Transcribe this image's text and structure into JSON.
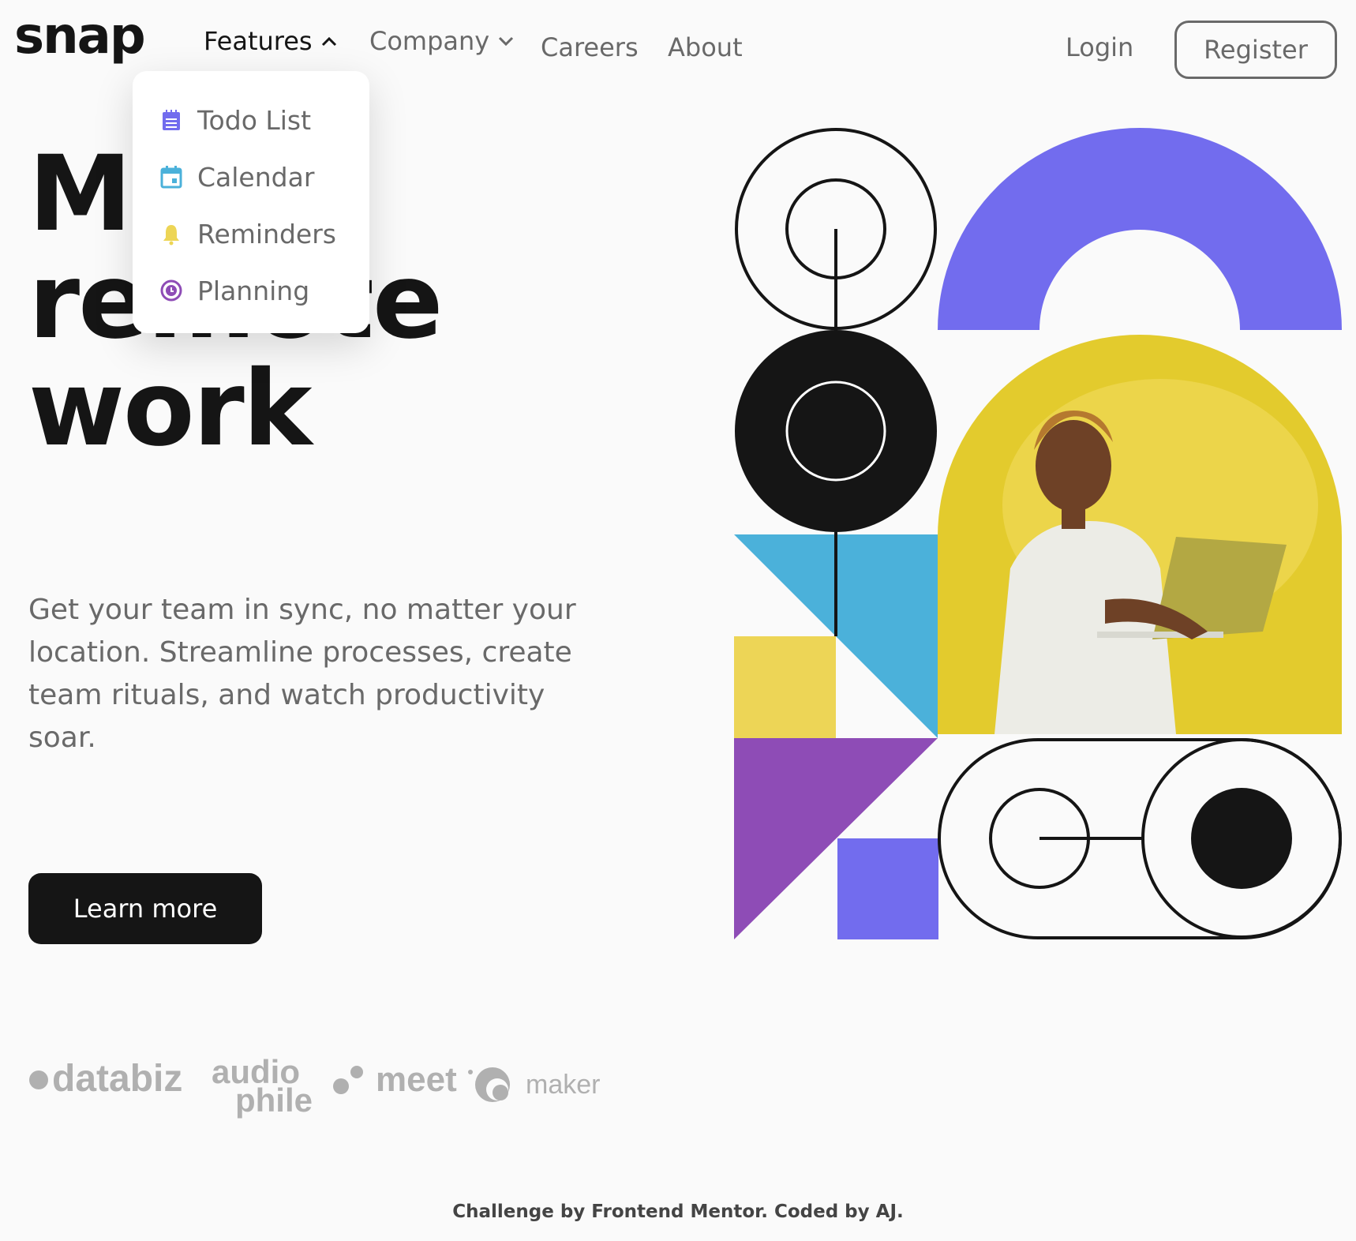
{
  "header": {
    "logo": "snap",
    "nav": [
      {
        "label": "Features",
        "expanded": true
      },
      {
        "label": "Company",
        "expanded": false
      },
      {
        "label": "Careers"
      },
      {
        "label": "About"
      }
    ],
    "login_label": "Login",
    "register_label": "Register"
  },
  "features_menu": [
    {
      "label": "Todo List",
      "icon": "todo-icon",
      "color": "#726cee"
    },
    {
      "label": "Calendar",
      "icon": "calendar-icon",
      "color": "#4bb1da"
    },
    {
      "label": "Reminders",
      "icon": "bell-icon",
      "color": "#edd556"
    },
    {
      "label": "Planning",
      "icon": "planning-icon",
      "color": "#8e4cb6"
    }
  ],
  "hero": {
    "title_line1": "Make",
    "title_line2": "remote",
    "title_line3": "work",
    "description": "Get your team in sync, no matter your location. Streamline processes, create team rituals, and watch productivity soar.",
    "cta_label": "Learn more"
  },
  "clients": [
    {
      "name": "databiz"
    },
    {
      "name": "audio",
      "sub": "phile"
    },
    {
      "name": "meet"
    },
    {
      "name": "maker"
    }
  ],
  "footer": {
    "attribution": "Challenge by Frontend Mentor. Coded by AJ."
  },
  "colors": {
    "text": "#151515",
    "muted": "#696969",
    "purple": "#726cee",
    "blue": "#4bb1da",
    "yellow": "#edd556",
    "violet": "#8e4cb6",
    "photo_bg": "#e3cb2d"
  }
}
